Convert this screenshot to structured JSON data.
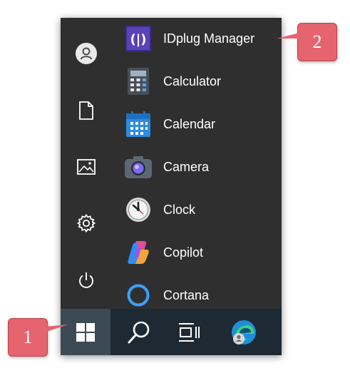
{
  "apps": [
    {
      "label": "IDplug Manager",
      "icon": "idplug-icon"
    },
    {
      "label": "Calculator",
      "icon": "calculator-icon"
    },
    {
      "label": "Calendar",
      "icon": "calendar-icon"
    },
    {
      "label": "Camera",
      "icon": "camera-icon"
    },
    {
      "label": "Clock",
      "icon": "clock-icon"
    },
    {
      "label": "Copilot",
      "icon": "copilot-icon"
    },
    {
      "label": "Cortana",
      "icon": "cortana-icon"
    }
  ],
  "rail": [
    {
      "icon": "user-avatar-icon"
    },
    {
      "icon": "documents-icon"
    },
    {
      "icon": "pictures-icon"
    },
    {
      "icon": "settings-gear-icon"
    },
    {
      "icon": "power-icon"
    }
  ],
  "taskbar": [
    {
      "icon": "windows-start-icon"
    },
    {
      "icon": "search-icon"
    },
    {
      "icon": "task-view-icon"
    },
    {
      "icon": "edge-profile-icon"
    }
  ],
  "callouts": {
    "one": "1",
    "two": "2"
  },
  "colors": {
    "panel": "#2f2f2f",
    "taskbar": "#1e2a33",
    "callout": "#e6646d"
  }
}
